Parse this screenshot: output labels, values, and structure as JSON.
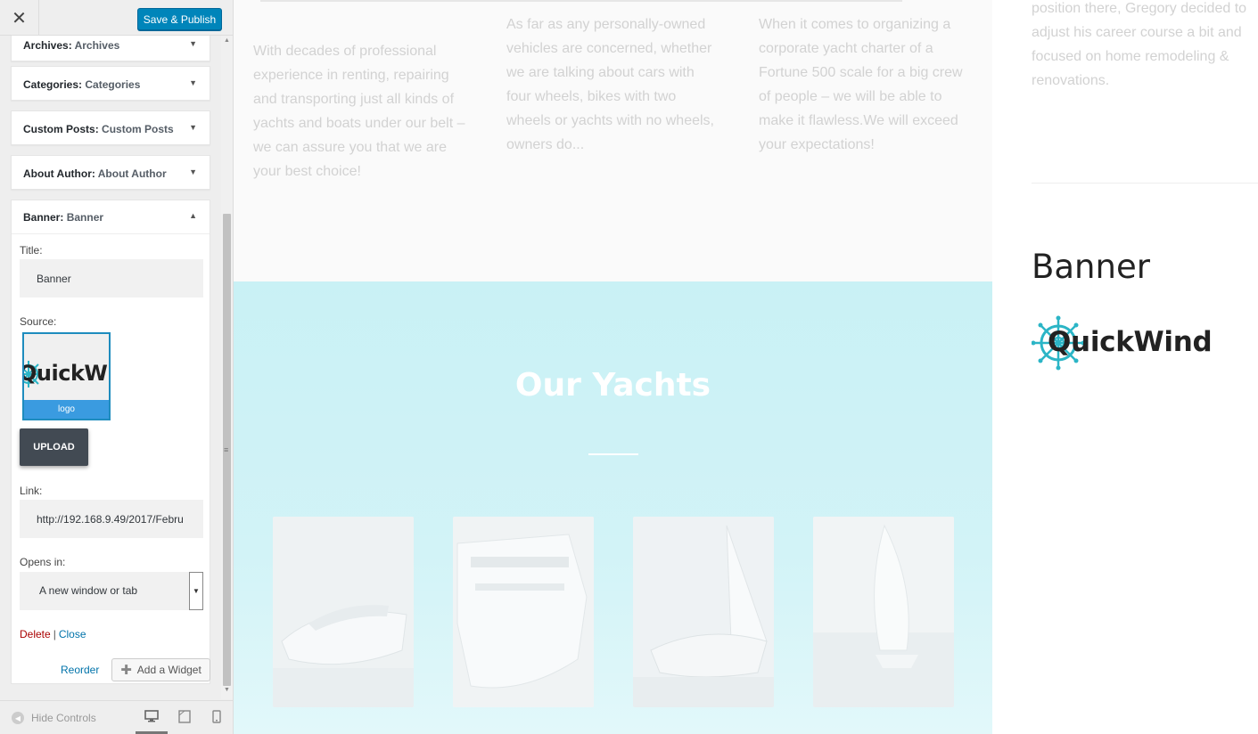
{
  "topbar": {
    "close_glyph": "✕",
    "save_label": "Save & Publish"
  },
  "widgets": [
    {
      "name": "Archives",
      "title": "Archives"
    },
    {
      "name": "Categories",
      "title": "Categories"
    },
    {
      "name": "Custom Posts",
      "title": "Custom Posts"
    },
    {
      "name": "About Author",
      "title": "About Author"
    }
  ],
  "banner_widget": {
    "name": "Banner",
    "title_sub": "Banner",
    "title_label": "Title:",
    "title_value": "Banner",
    "source_label": "Source:",
    "thumb_text": "QuickWind",
    "thumb_caption": "logo",
    "upload_label": "UPLOAD",
    "link_label": "Link:",
    "link_value": "http://192.168.9.49/2017/Febru",
    "opens_label": "Opens in:",
    "opens_value": "A new window or tab",
    "delete_label": "Delete",
    "separator": "|",
    "close_label": "Close"
  },
  "panel_actions": {
    "reorder_label": "Reorder",
    "add_widget_label": "Add a Widget"
  },
  "footer": {
    "hide_controls_label": "Hide Controls",
    "devices": [
      "desktop-icon",
      "tablet-icon",
      "mobile-icon"
    ]
  },
  "preview": {
    "col1_text": "With decades of professional experience in renting, repairing and transporting just all kinds of yachts and boats under our belt – we can assure you that we are your best choice!",
    "col2_text": "As far as any personally-owned vehicles are concerned, whether we are talking about cars with four wheels, bikes with two wheels or yachts with no wheels, owners do...",
    "col3_text": "When it comes to organizing a corporate yacht charter of a Fortune 500 scale for a big crew of people – we will be able to make it flawless.We will exceed your expectations!",
    "yachts_title": "Our Yachts",
    "right_text": "position there, Gregory decided to adjust his career course a bit and focused on home remodeling & renovations.",
    "banner_heading": "Banner",
    "banner_logo_text": "QuickWind"
  },
  "colors": {
    "accent": "#0085ba",
    "yachts_bg": "#c9f1f5",
    "logo_teal": "#2bb5c6"
  }
}
